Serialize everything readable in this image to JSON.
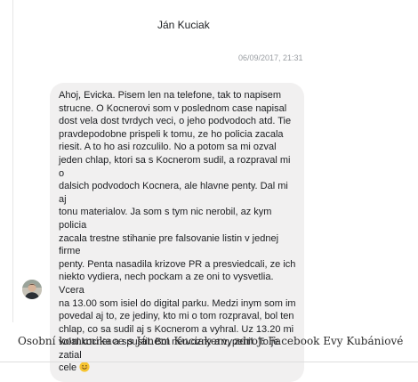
{
  "conversation": {
    "contact_name": "Ján Kuciak",
    "timestamp": "06/09/2017, 21:31",
    "message": {
      "text": "Ahoj, Evicka. Pisem len na telefone, tak to napisem\nstrucne. O Kocnerovi som v poslednom case napisal\ndost vela dost tvrdych veci, o jeho podvodoch atd. Tie\npravdepodobne prispeli k tomu, ze ho policia zacala\nriesit. A to ho asi rozculilo. No a potom sa mi ozval\njeden chlap, ktori sa s Kocnerom sudil, a rozpraval mi o\ndalsich podvodoch Kocnera, ale hlavne penty. Dal mi aj\ntonu materialov. Ja som s tym nic nerobil, az kym policia\nzacala trestne stihanie pre falsovanie listin v jednej firme\npenty. Penta nasadila krizove PR a presviedcali, ze ich\nniekto vydiera, nech pockam a ze oni to vysvetlia. Vcera\nna 13.00 som isiel do digital parku. Medzi inym som im\npovedal aj to, ze jediny, kto mi o tom rozpraval, bol ten\nchlap, co sa sudil aj s Kocnerom a vyhral. Uz 13.20 mi\nvolal kocner a spustil. Bol nervozny a vypenil. To je zatial\ncele",
      "emoji": "😊"
    }
  },
  "caption": "Osobní komunikace s Jánem Kuciakem, zdroj: Facebook Evy Kubániové",
  "icons": {
    "avatar": "user-avatar-photo",
    "emoji": "smiling-face-emoji"
  },
  "colors": {
    "bubble_background": "#f1f0f0",
    "text": "#1c1e21",
    "timestamp": "#9a9ea3",
    "emoji": "#f7c531"
  }
}
